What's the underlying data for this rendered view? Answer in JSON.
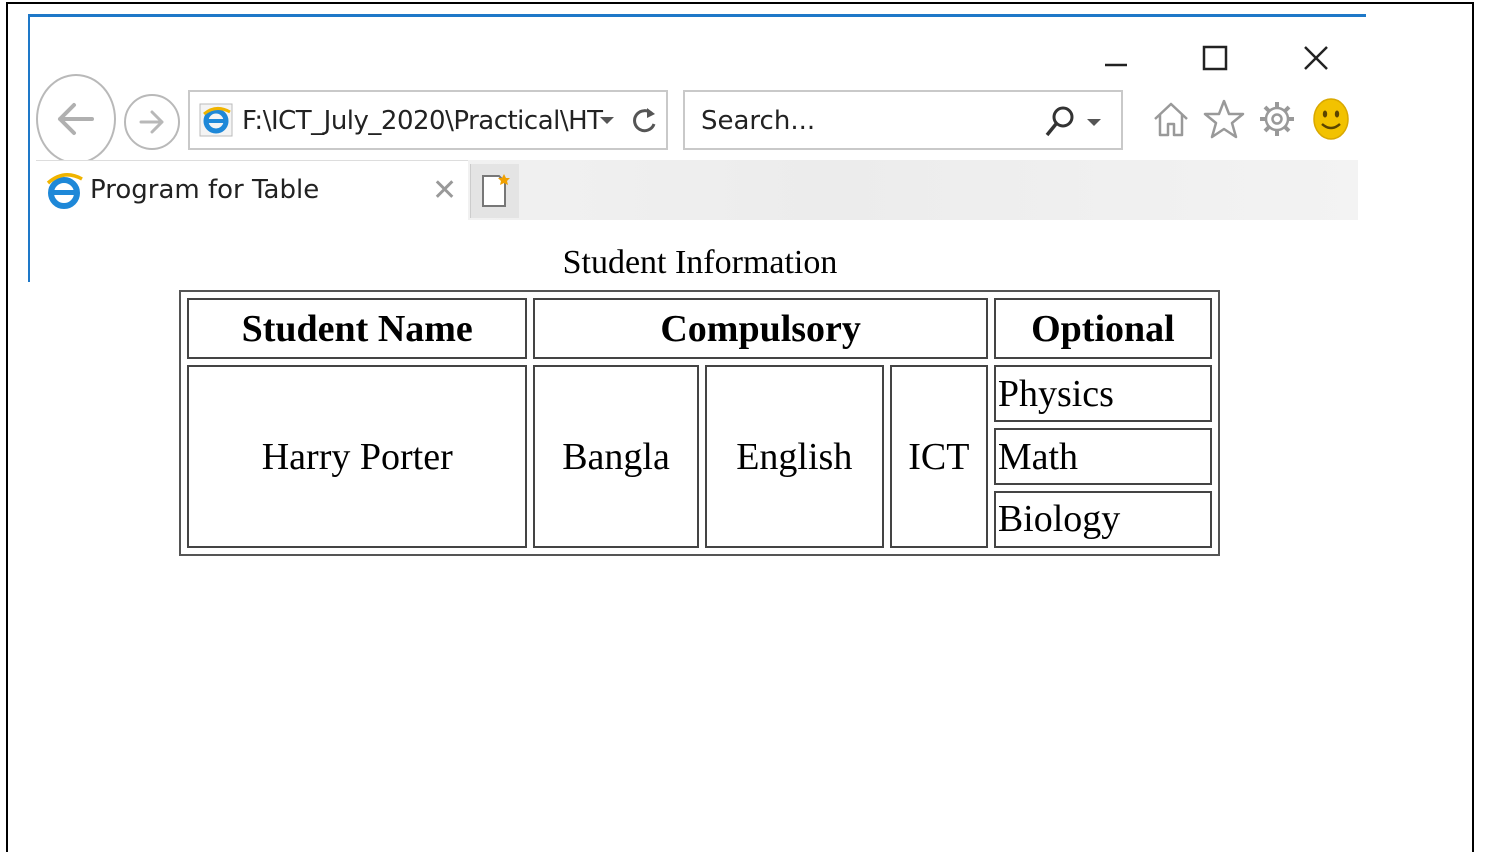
{
  "browser": {
    "address": "F:\\ICT_July_2020\\Practical\\HT",
    "search_placeholder": "Search...",
    "tab_title": "Program for Table"
  },
  "page": {
    "caption": "Student Information",
    "headers": {
      "student_name": "Student Name",
      "compulsory": "Compulsory",
      "optional": "Optional"
    },
    "student": "Harry Porter",
    "compulsory_subjects": [
      "Bangla",
      "English",
      "ICT"
    ],
    "optional_subjects": [
      "Physics",
      "Math",
      "Biology"
    ]
  },
  "colors": {
    "accent": "#1e78c8",
    "smiley": "#f2c200"
  }
}
